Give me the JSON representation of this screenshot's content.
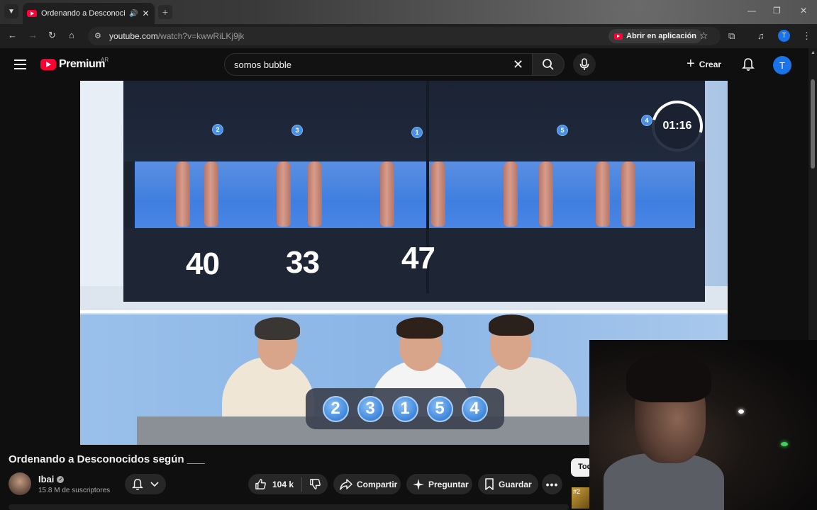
{
  "browser": {
    "tab_title": "Ordenando a Desconocidos según ___",
    "tab_menu_icon": "chevron-down-icon",
    "url_host": "youtube.com",
    "url_path": "/watch?v=kwwRiLKj9jk",
    "open_in_app_label": "Abrir en aplicación",
    "profile_initial": "T"
  },
  "header": {
    "logo_text": "Premium",
    "logo_region": "AR",
    "search_value": "somos bubble",
    "create_label": "Crear",
    "avatar_initial": "T"
  },
  "video_frame": {
    "position_badges": [
      "2",
      "3",
      "1",
      "5",
      "4"
    ],
    "ages": [
      "40",
      "33",
      "47"
    ],
    "timer": "01:16",
    "order_chips": [
      "2",
      "3",
      "1",
      "5",
      "4"
    ]
  },
  "video_info": {
    "title": "Ordenando a Desconocidos según ___",
    "channel_name": "Ibai",
    "subscribers": "15.8 M de suscriptores",
    "like_count": "104 k",
    "share_label": "Compartir",
    "ask_label": "Preguntar",
    "save_label": "Guardar",
    "chip_label": "Todo",
    "peek_label": "#2"
  },
  "colors": {
    "brand_red": "#ff0033",
    "avatar_blue": "#1a73e8",
    "badge_blue": "#4a90e2"
  }
}
